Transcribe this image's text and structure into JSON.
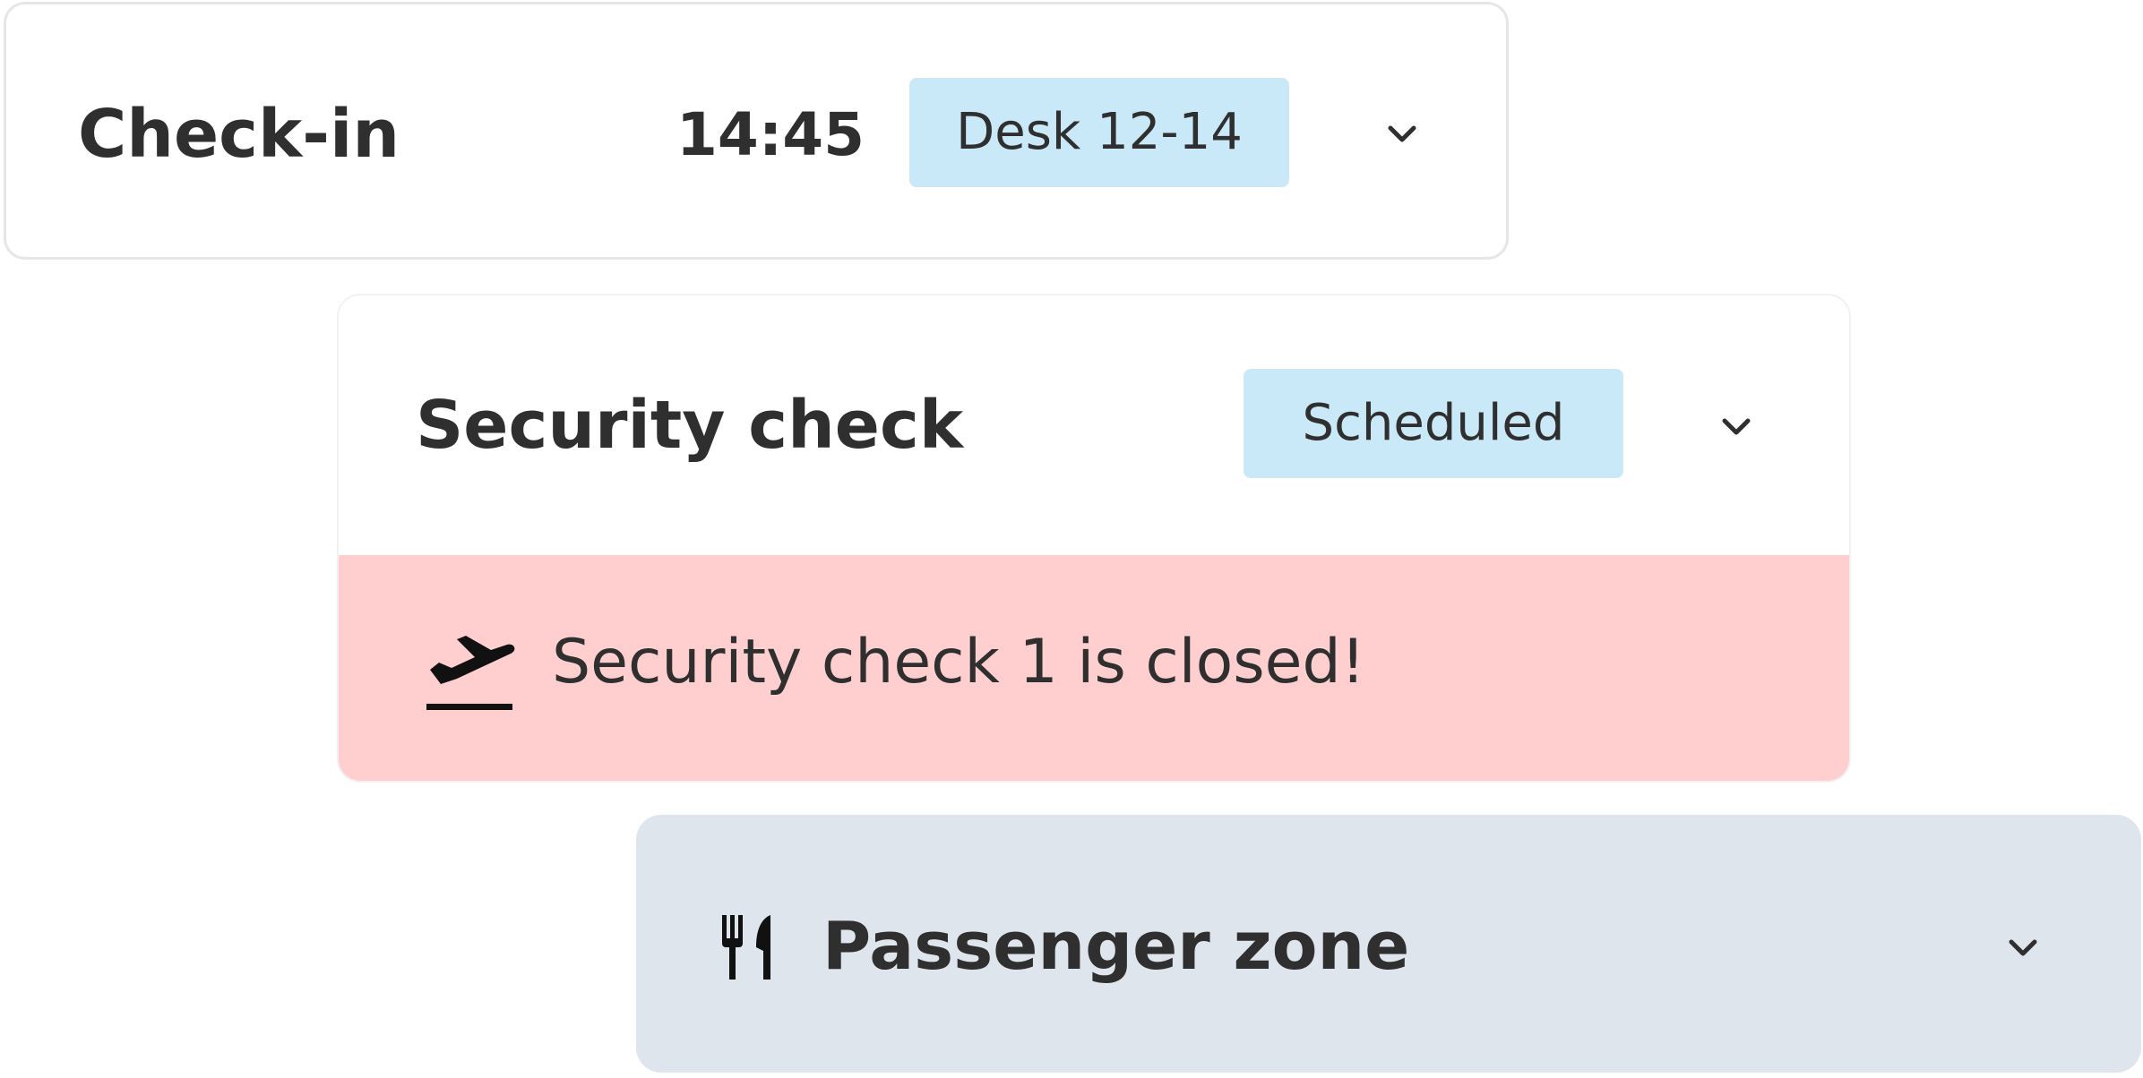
{
  "checkin": {
    "title": "Check-in",
    "time": "14:45",
    "badge": "Desk 12-14",
    "chevron_icon": "chevron-down-icon"
  },
  "security": {
    "title": "Security check",
    "badge": "Scheduled",
    "chevron_icon": "chevron-down-icon",
    "alert": {
      "icon": "flight-takeoff-icon",
      "text": "Security check 1 is closed!"
    }
  },
  "zone": {
    "icon": "fork-knife-icon",
    "title": "Passenger zone",
    "chevron_icon": "chevron-down-icon"
  },
  "colors": {
    "badge_bg": "#c9e9f8",
    "alert_bg": "#ffcfcf",
    "zone_bg": "#dfe5ec",
    "text": "#2f2f2f"
  }
}
